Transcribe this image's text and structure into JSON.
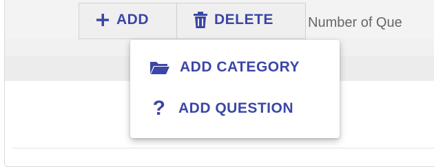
{
  "toolbar": {
    "add_label": "ADD",
    "delete_label": "DELETE",
    "column_header": "Number of Que"
  },
  "add_menu": {
    "items": [
      {
        "label": "ADD CATEGORY",
        "icon": "folder-open-icon"
      },
      {
        "label": "ADD QUESTION",
        "icon": "question-mark-icon"
      }
    ]
  },
  "colors": {
    "accent": "#3b46a6",
    "toolbar_bg": "#efefef",
    "menu_bg": "#ffffff"
  }
}
